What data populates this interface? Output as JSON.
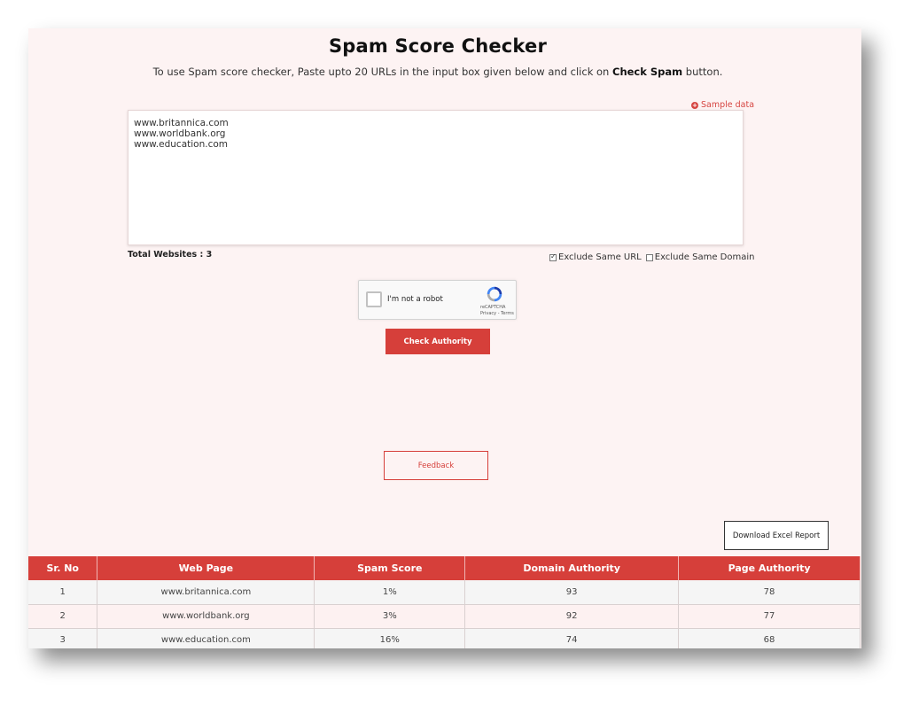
{
  "header": {
    "title": "Spam Score Checker",
    "instruction_prefix": "To use Spam score checker, Paste upto 20 URLs in the input box given below and click on ",
    "instruction_bold": "Check Spam",
    "instruction_suffix": " button."
  },
  "sample_data_label": "Sample data",
  "input": {
    "value": "www.britannica.com\nwww.worldbank.org\nwww.education.com"
  },
  "total_websites": "Total Websites : 3",
  "options": {
    "exclude_same_url": {
      "label": "Exclude Same URL",
      "checked": true
    },
    "exclude_same_domain": {
      "label": "Exclude Same Domain",
      "checked": false
    }
  },
  "captcha": {
    "label": "I'm not a robot",
    "brand": "reCAPTCHA",
    "links": "Privacy - Terms"
  },
  "buttons": {
    "check_authority": "Check Authority",
    "feedback": "Feedback",
    "download_report": "Download Excel Report"
  },
  "table": {
    "headers": [
      "Sr. No",
      "Web Page",
      "Spam Score",
      "Domain Authority",
      "Page Authority"
    ],
    "rows": [
      [
        "1",
        "www.britannica.com",
        "1%",
        "93",
        "78"
      ],
      [
        "2",
        "www.worldbank.org",
        "3%",
        "92",
        "77"
      ],
      [
        "3",
        "www.education.com",
        "16%",
        "74",
        "68"
      ]
    ]
  },
  "colors": {
    "accent": "#d63f3a",
    "panel_bg": "#fdf3f3"
  }
}
